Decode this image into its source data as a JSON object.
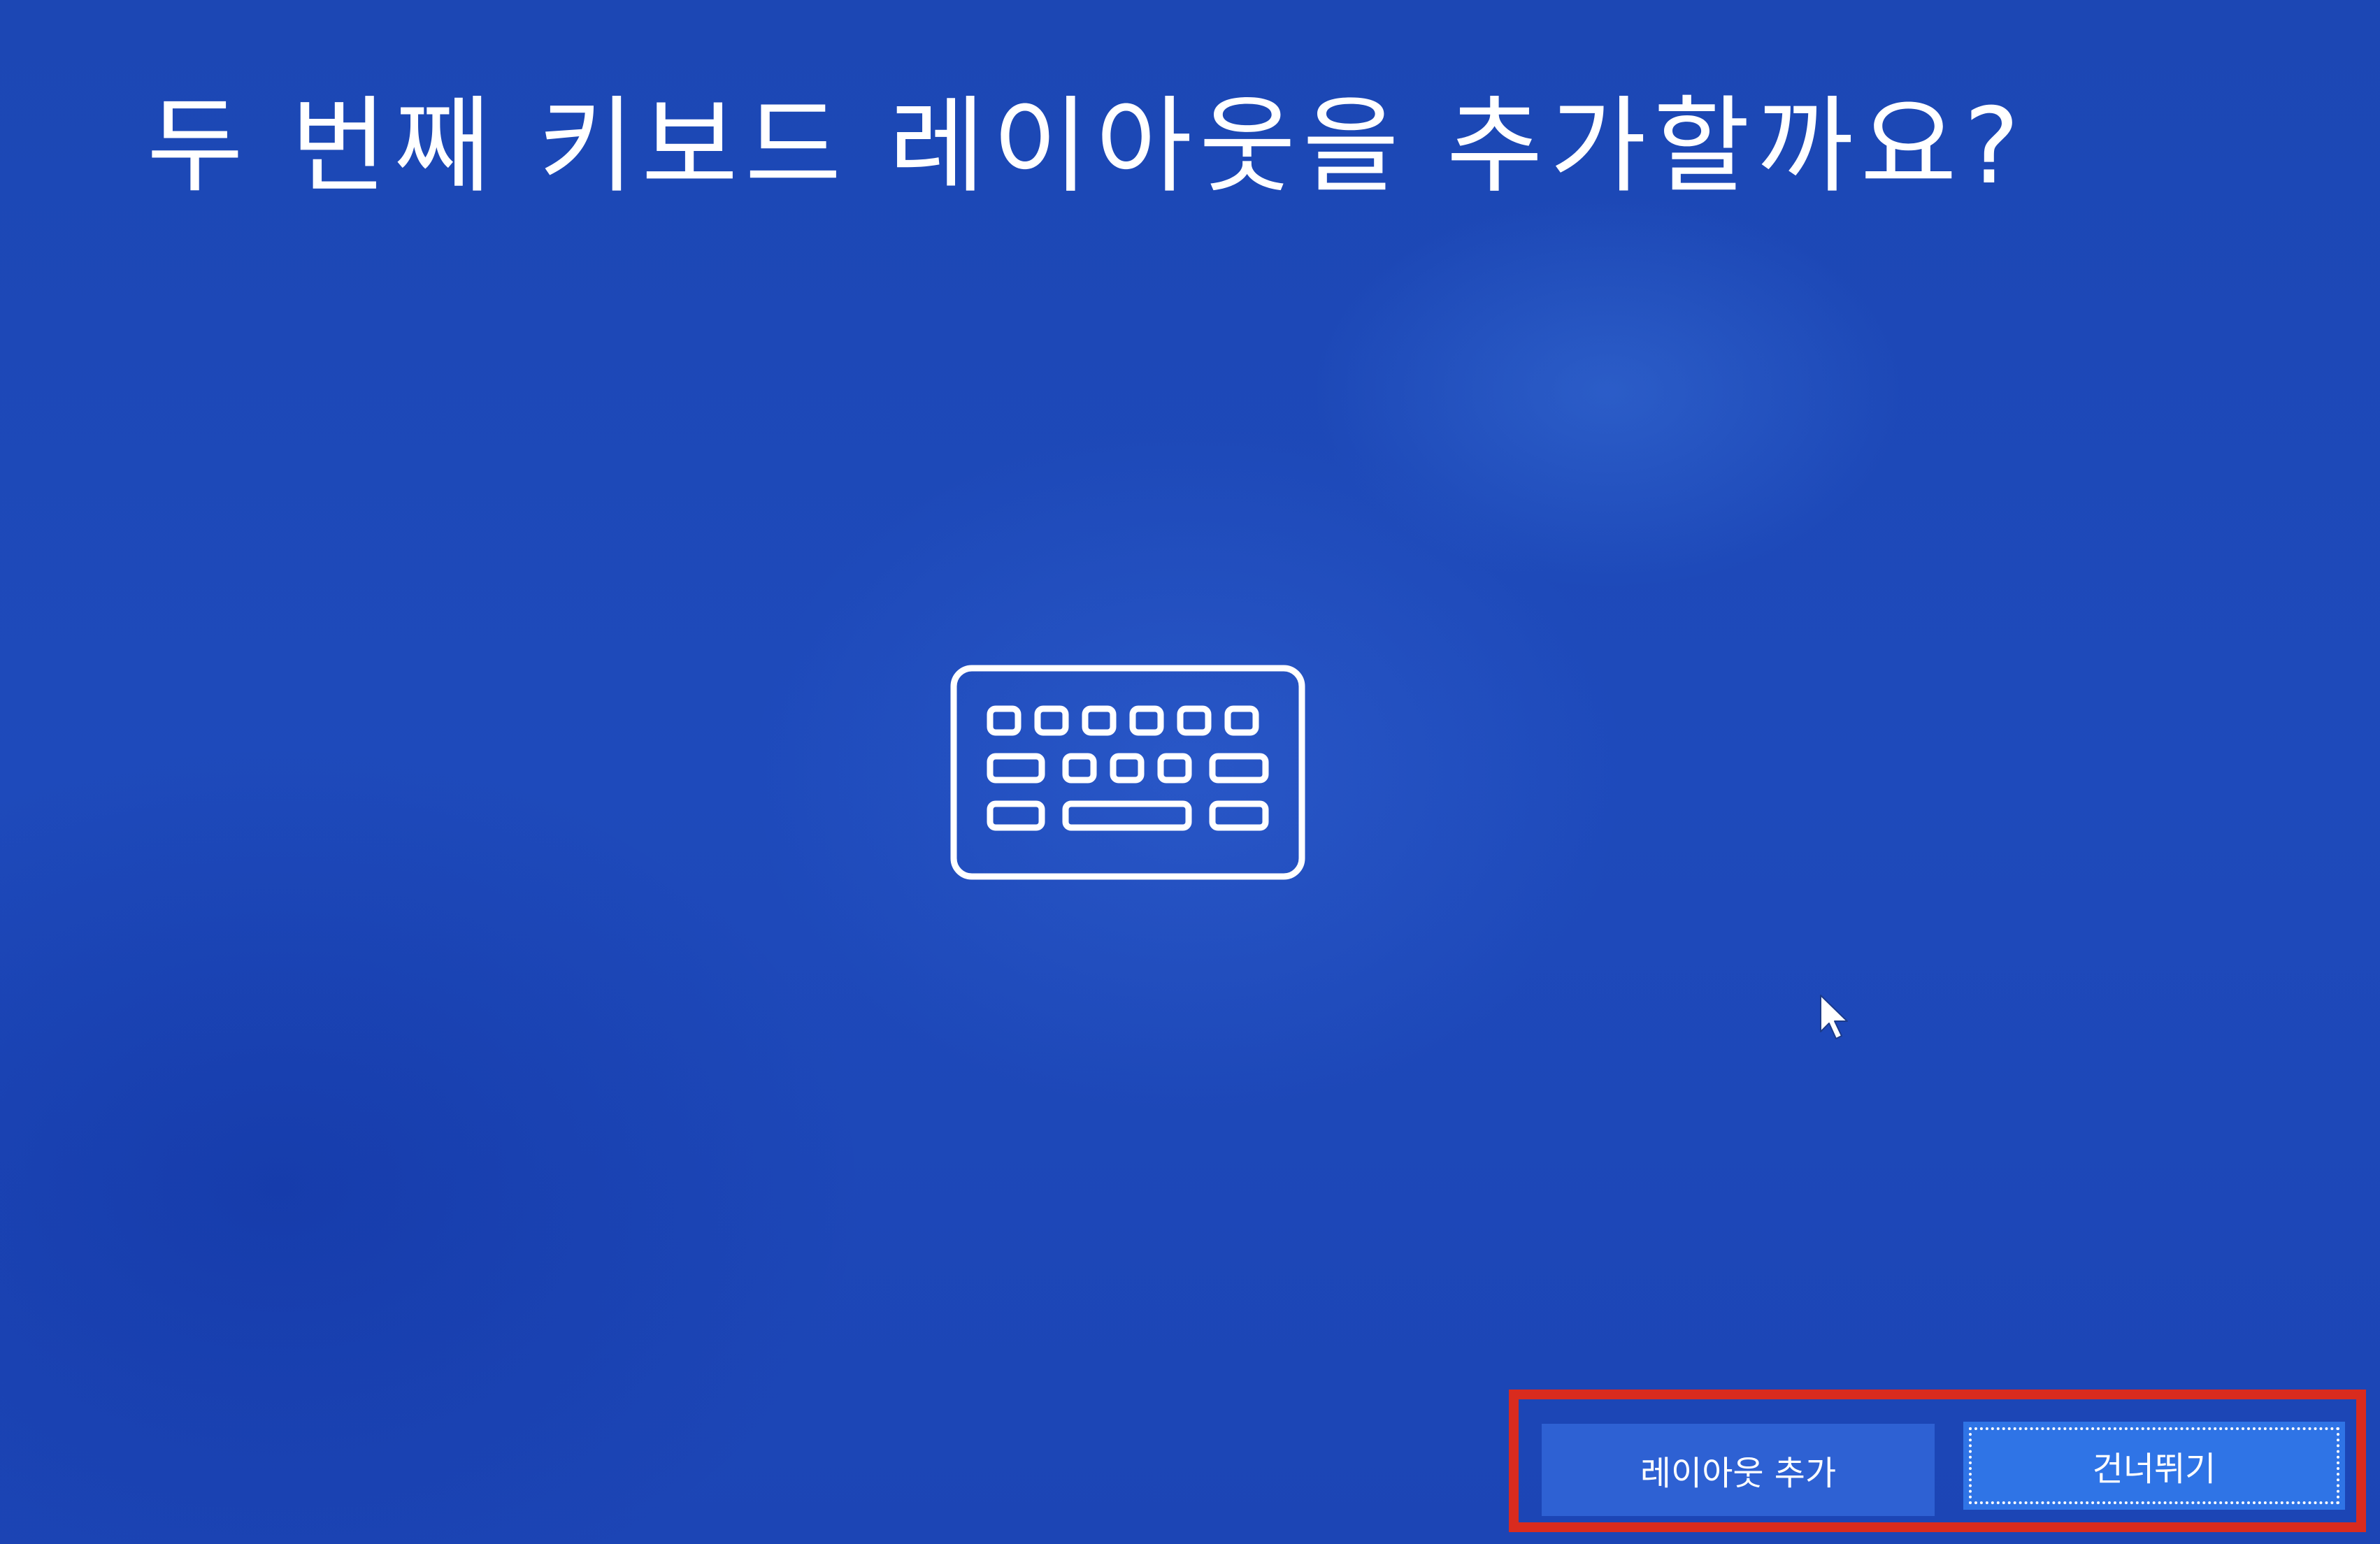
{
  "page": {
    "title": "두 번째 키보드 레이아웃을 추가할까요?"
  },
  "buttons": {
    "add_layout": "레이아웃 추가",
    "skip": "건너뛰기"
  },
  "icons": {
    "main": "keyboard-icon",
    "pointer": "mouse-cursor-icon"
  },
  "colors": {
    "background": "#1d46b6",
    "button_primary": "#2f74e6",
    "button_secondary": "#2e61d3",
    "highlight": "#d92b1e"
  }
}
